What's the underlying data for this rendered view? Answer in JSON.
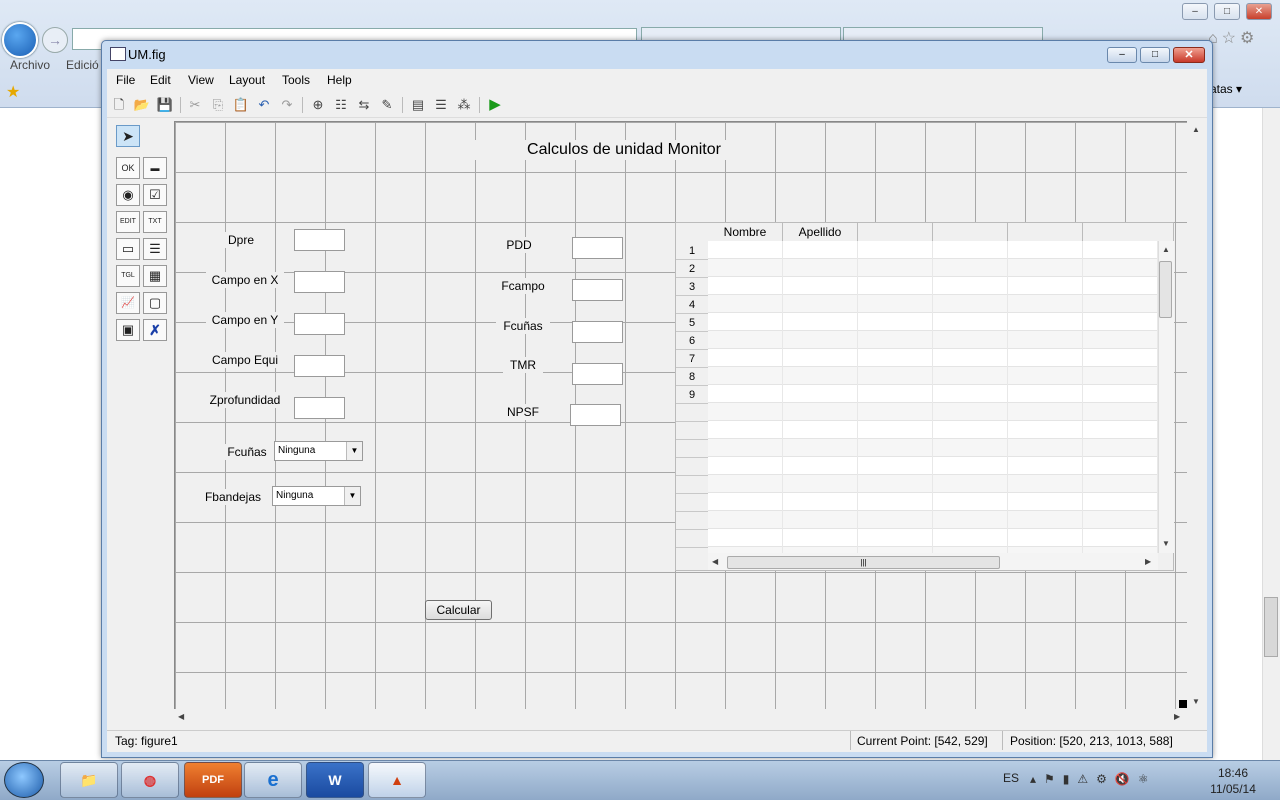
{
  "browser": {
    "menu_archivo": "Archivo",
    "menu_edicion": "Edició",
    "favoritas": "atas ▾"
  },
  "window": {
    "title": "UM.fig",
    "min": "–",
    "max": "□",
    "close": "✕"
  },
  "menubar": [
    "File",
    "Edit",
    "View",
    "Layout",
    "Tools",
    "Help"
  ],
  "palette": {
    "pushbutton": "OK",
    "slider": "▬",
    "radio": "◉",
    "checkbox": "☑",
    "edit": "EDIT",
    "text": "TXT",
    "popup": "▭",
    "listbox": "☰",
    "toggle": "TGL",
    "table": "▦",
    "axes": "📈",
    "panel": "▢",
    "buttongroup": "▣",
    "activex": "✗"
  },
  "gui": {
    "title": "Calculos de unidad Monitor",
    "left_labels": [
      "Dpre",
      "Campo en X",
      "Campo en Y",
      "Campo Equi",
      "Zprofundidad"
    ],
    "fcunas_label": "Fcuñas",
    "fbandejas_label": "Fbandejas",
    "popup_value_1": "Ninguna",
    "popup_value_2": "Ninguna",
    "right_labels": [
      "PDD",
      "Fcampo",
      "Fcuñas",
      "TMR",
      "NPSF"
    ],
    "calc_button": "Calcular"
  },
  "table": {
    "columns": [
      "Nombre",
      "Apellido",
      "",
      "",
      "",
      ""
    ],
    "row_numbers": [
      "1",
      "2",
      "3",
      "4",
      "5",
      "6",
      "7",
      "8",
      "9"
    ]
  },
  "status": {
    "tag": "Tag: figure1",
    "current_point": "Current Point:  [542, 529]",
    "position": "Position: [520, 213, 1013, 588]"
  },
  "taskbar": {
    "lang": "ES",
    "time": "18:46",
    "date": "11/05/14",
    "apps": [
      "explorer",
      "chrome",
      "pdf",
      "ie",
      "word",
      "matlab"
    ]
  }
}
